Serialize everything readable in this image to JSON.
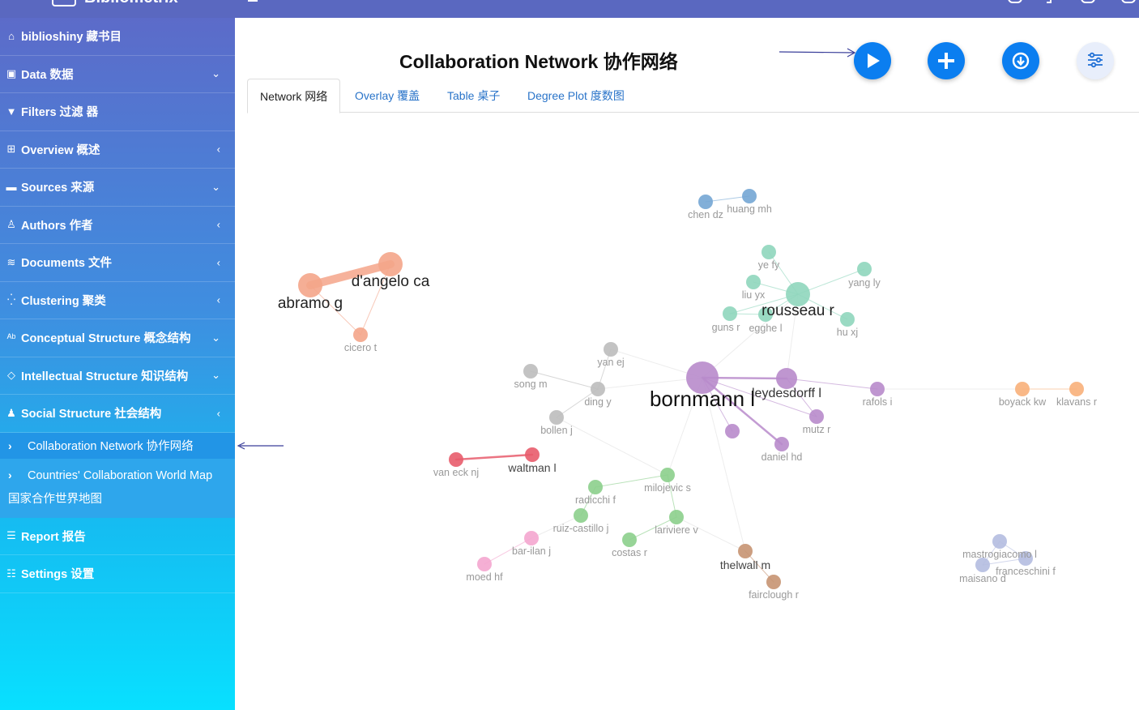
{
  "app": {
    "name": "Bibliometrix"
  },
  "sidebar": {
    "items": [
      {
        "label": "biblioshiny 藏书目",
        "icon": "home-icon",
        "glyph": "⌂",
        "arrow": ""
      },
      {
        "label": "Data 数据",
        "icon": "file-upload-icon",
        "glyph": "▣",
        "arrow": "⌄"
      },
      {
        "label": "Filters 过滤 器",
        "icon": "filter-icon",
        "glyph": "▼",
        "arrow": ""
      },
      {
        "label": "Overview 概述",
        "icon": "table-icon",
        "glyph": "⊞",
        "arrow": "‹"
      },
      {
        "label": "Sources 来源",
        "icon": "book-icon",
        "glyph": "▬",
        "arrow": "⌄"
      },
      {
        "label": "Authors 作者",
        "icon": "user-icon",
        "glyph": "♙",
        "arrow": "‹"
      },
      {
        "label": "Documents 文件",
        "icon": "layers-icon",
        "glyph": "≋",
        "arrow": "‹"
      },
      {
        "label": "Clustering 聚类",
        "icon": "spinner-icon",
        "glyph": "⁛",
        "arrow": "‹"
      },
      {
        "label": "Conceptual Structure 概念结构",
        "icon": "spell-check-icon",
        "glyph": "ᴬᵇ",
        "arrow": "⌄"
      },
      {
        "label": "Intellectual Structure 知识结构",
        "icon": "gem-icon",
        "glyph": "◇",
        "arrow": "⌄"
      },
      {
        "label": "Social Structure 社会结构",
        "icon": "users-icon",
        "glyph": "♟",
        "arrow": "‹"
      }
    ],
    "subitems": [
      {
        "label": "Collaboration Network  协作网络"
      },
      {
        "label": "Countries' Collaboration World Map",
        "label2": "国家合作世界地图"
      }
    ],
    "bottom": [
      {
        "label": "Report 报告",
        "icon": "list-alt-icon",
        "glyph": "☰"
      },
      {
        "label": "Settings 设置",
        "icon": "sliders-icon",
        "glyph": "☷"
      }
    ]
  },
  "main": {
    "title": "Collaboration Network 协作网络",
    "tabs": [
      {
        "label": "Network 网络",
        "active": true
      },
      {
        "label": "Overlay 覆盖",
        "active": false
      },
      {
        "label": "Table 桌子",
        "active": false
      },
      {
        "label": "Degree Plot 度数图",
        "active": false
      }
    ],
    "buttons": [
      {
        "name": "play-button",
        "icon": "play-icon"
      },
      {
        "name": "add-button",
        "icon": "plus-icon"
      },
      {
        "name": "download-button",
        "icon": "download-icon"
      },
      {
        "name": "options-button",
        "icon": "sliders-icon"
      }
    ]
  },
  "network": {
    "colors": {
      "salmon": "#f4a58a",
      "teal": "#8fd6bc",
      "blue": "#74a6d4",
      "gray": "#bdbdbd",
      "purple": "#b88bcb",
      "red": "#e85c6c",
      "green": "#8ccf8c",
      "pink": "#f4a6cf",
      "brown": "#c69372",
      "orange": "#f8b07a",
      "lavender": "#b4bde0"
    },
    "nodes": [
      {
        "id": "abramo",
        "label": "abramo g",
        "color": "salmon",
        "size": 3,
        "big": true
      },
      {
        "id": "dangelo",
        "label": "d'angelo ca",
        "color": "salmon",
        "size": 3,
        "big": true
      },
      {
        "id": "cicero",
        "label": "cicero t",
        "color": "salmon",
        "size": 1
      },
      {
        "id": "chen",
        "label": "chen dz",
        "color": "blue",
        "size": 1
      },
      {
        "id": "huang",
        "label": "huang mh",
        "color": "blue",
        "size": 1
      },
      {
        "id": "ye",
        "label": "ye fy",
        "color": "teal",
        "size": 1
      },
      {
        "id": "yang",
        "label": "yang ly",
        "color": "teal",
        "size": 1
      },
      {
        "id": "liu",
        "label": "liu yx",
        "color": "teal",
        "size": 1
      },
      {
        "id": "rousseau",
        "label": "rousseau r",
        "color": "teal",
        "size": 3,
        "big": true
      },
      {
        "id": "guns",
        "label": "guns r",
        "color": "teal",
        "size": 1
      },
      {
        "id": "egghe",
        "label": "egghe l",
        "color": "teal",
        "size": 1
      },
      {
        "id": "hu",
        "label": "hu xj",
        "color": "teal",
        "size": 1
      },
      {
        "id": "yanej",
        "label": "yan ej",
        "color": "gray",
        "size": 1
      },
      {
        "id": "song",
        "label": "song m",
        "color": "gray",
        "size": 1
      },
      {
        "id": "ding",
        "label": "ding y",
        "color": "gray",
        "size": 1
      },
      {
        "id": "bollen",
        "label": "bollen j",
        "color": "gray",
        "size": 1
      },
      {
        "id": "bornmann",
        "label": "bornmann l",
        "color": "purple",
        "size": 4,
        "big": true
      },
      {
        "id": "leydesdorff",
        "label": "leydesdorff l",
        "color": "purple",
        "size": 2,
        "big": true
      },
      {
        "id": "rafols",
        "label": "rafols i",
        "color": "purple",
        "size": 1
      },
      {
        "id": "mutz",
        "label": "mutz r",
        "color": "purple",
        "size": 1
      },
      {
        "id": "p_unl",
        "label": "",
        "color": "purple",
        "size": 1
      },
      {
        "id": "daniel",
        "label": "daniel hd",
        "color": "purple",
        "size": 1
      },
      {
        "id": "boyack",
        "label": "boyack kw",
        "color": "orange",
        "size": 1
      },
      {
        "id": "klavans",
        "label": "klavans r",
        "color": "orange",
        "size": 1
      },
      {
        "id": "vaneck",
        "label": "van eck nj",
        "color": "red",
        "size": 1
      },
      {
        "id": "waltman",
        "label": "waltman l",
        "color": "red",
        "size": 1,
        "big": true
      },
      {
        "id": "milojevic",
        "label": "milojevic s",
        "color": "green",
        "size": 1
      },
      {
        "id": "radicchi",
        "label": "radicchi f",
        "color": "green",
        "size": 1
      },
      {
        "id": "ruiz",
        "label": "ruiz-castillo j",
        "color": "green",
        "size": 1
      },
      {
        "id": "lariviere",
        "label": "lariviere v",
        "color": "green",
        "size": 1
      },
      {
        "id": "costas",
        "label": "costas r",
        "color": "green",
        "size": 1
      },
      {
        "id": "barilan",
        "label": "bar-ilan j",
        "color": "pink",
        "size": 1
      },
      {
        "id": "moed",
        "label": "moed hf",
        "color": "pink",
        "size": 1
      },
      {
        "id": "thelwall",
        "label": "thelwall m",
        "color": "brown",
        "size": 1,
        "big": true
      },
      {
        "id": "fairclough",
        "label": "fairclough r",
        "color": "brown",
        "size": 1
      },
      {
        "id": "mastrogiacomo",
        "label": "mastrogiacomo l",
        "color": "lavender",
        "size": 1
      },
      {
        "id": "franceschini",
        "label": "franceschini f",
        "color": "lavender",
        "size": 1
      },
      {
        "id": "maisano",
        "label": "maisano d",
        "color": "lavender",
        "size": 1
      }
    ],
    "edges": [
      [
        "abramo",
        "dangelo",
        3
      ],
      [
        "abramo",
        "cicero",
        1
      ],
      [
        "dangelo",
        "cicero",
        1
      ],
      [
        "chen",
        "huang",
        1
      ],
      [
        "rousseau",
        "ye",
        1
      ],
      [
        "rousseau",
        "liu",
        1
      ],
      [
        "rousseau",
        "yang",
        1
      ],
      [
        "rousseau",
        "guns",
        1
      ],
      [
        "rousseau",
        "egghe",
        1
      ],
      [
        "rousseau",
        "hu",
        1
      ],
      [
        "egghe",
        "guns",
        1
      ],
      [
        "rousseau",
        "bornmann",
        1
      ],
      [
        "bornmann",
        "leydesdorff",
        2
      ],
      [
        "bornmann",
        "daniel",
        2
      ],
      [
        "bornmann",
        "mutz",
        1
      ],
      [
        "bornmann",
        "p_unl",
        1
      ],
      [
        "leydesdorff",
        "mutz",
        1
      ],
      [
        "leydesdorff",
        "rafols",
        1
      ],
      [
        "leydesdorff",
        "rousseau",
        1
      ],
      [
        "bornmann",
        "ding",
        1
      ],
      [
        "ding",
        "yanej",
        1
      ],
      [
        "ding",
        "song",
        1
      ],
      [
        "ding",
        "bollen",
        1
      ],
      [
        "bornmann",
        "milojevic",
        1
      ],
      [
        "bornmann",
        "thelwall",
        1
      ],
      [
        "boyack",
        "klavans",
        1
      ],
      [
        "rafols",
        "boyack",
        1
      ],
      [
        "vaneck",
        "waltman",
        2
      ],
      [
        "milojevic",
        "lariviere",
        1
      ],
      [
        "milojevic",
        "radicchi",
        1
      ],
      [
        "radicchi",
        "ruiz",
        1
      ],
      [
        "ruiz",
        "barilan",
        1
      ],
      [
        "barilan",
        "moed",
        1
      ],
      [
        "lariviere",
        "costas",
        1
      ],
      [
        "lariviere",
        "thelwall",
        1
      ],
      [
        "thelwall",
        "fairclough",
        1
      ],
      [
        "mastrogiacomo",
        "franceschini",
        1
      ],
      [
        "mastrogiacomo",
        "maisano",
        1
      ],
      [
        "maisano",
        "franceschini",
        1
      ],
      [
        "bollen",
        "milojevic",
        1
      ],
      [
        "yanej",
        "bornmann",
        1
      ]
    ]
  }
}
